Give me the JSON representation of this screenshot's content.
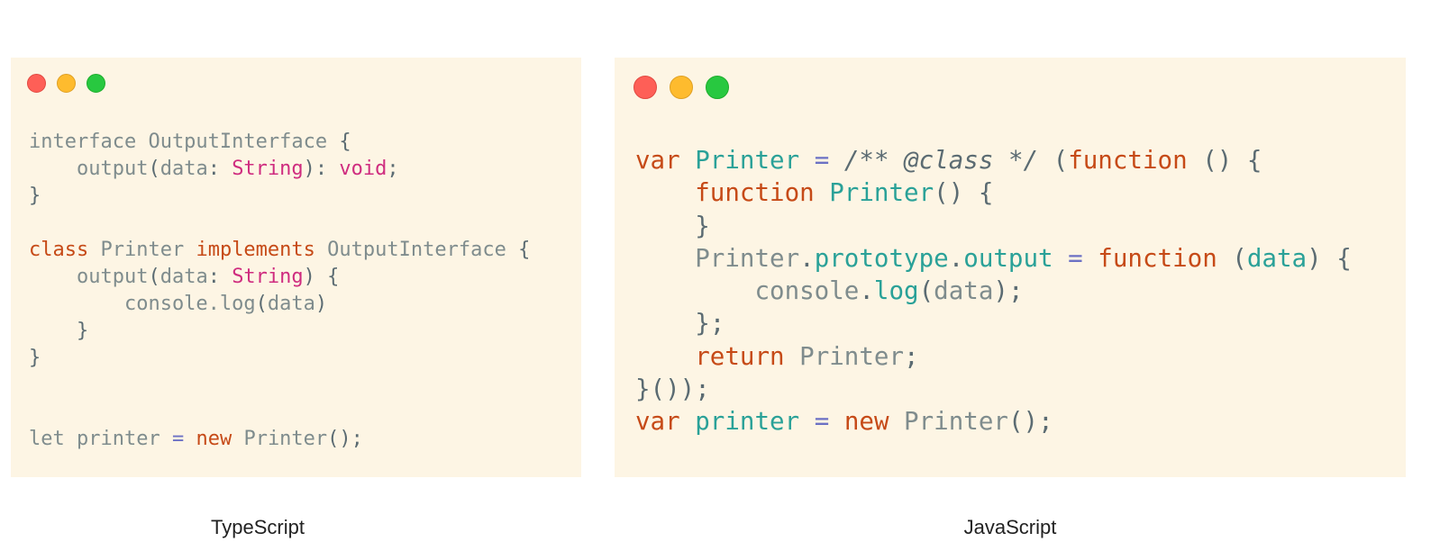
{
  "panels": {
    "typescript": {
      "caption": "TypeScript",
      "lines": [
        [
          [
            "nm",
            "interface OutputInterface "
          ],
          [
            "pl",
            "{"
          ]
        ],
        [
          [
            "nm",
            "    output"
          ],
          [
            "pl",
            "("
          ],
          [
            "nm",
            "data"
          ],
          [
            "pl",
            ": "
          ],
          [
            "ty",
            "String"
          ],
          [
            "pl",
            "): "
          ],
          [
            "ty",
            "void"
          ],
          [
            "pl",
            ";"
          ]
        ],
        [
          [
            "pl",
            "}"
          ]
        ],
        [],
        [
          [
            "kw",
            "class"
          ],
          [
            "nm",
            " Printer "
          ],
          [
            "kw",
            "implements"
          ],
          [
            "nm",
            " OutputInterface "
          ],
          [
            "pl",
            "{"
          ]
        ],
        [
          [
            "nm",
            "    output"
          ],
          [
            "pl",
            "("
          ],
          [
            "nm",
            "data"
          ],
          [
            "pl",
            ": "
          ],
          [
            "ty",
            "String"
          ],
          [
            "pl",
            ") {"
          ]
        ],
        [
          [
            "nm",
            "        console.log"
          ],
          [
            "pl",
            "("
          ],
          [
            "nm",
            "data"
          ],
          [
            "pl",
            ")"
          ]
        ],
        [
          [
            "pl",
            "    }"
          ]
        ],
        [
          [
            "pl",
            "}"
          ]
        ],
        [],
        [],
        [
          [
            "nm",
            "let printer "
          ],
          [
            "op",
            "="
          ],
          [
            "nm",
            " "
          ],
          [
            "kw",
            "new"
          ],
          [
            "nm",
            " Printer"
          ],
          [
            "pl",
            "();"
          ]
        ]
      ]
    },
    "javascript": {
      "caption": "JavaScript",
      "lines": [
        [
          [
            "kw",
            "var"
          ],
          [
            "pl",
            " "
          ],
          [
            "fn",
            "Printer"
          ],
          [
            "pl",
            " "
          ],
          [
            "op",
            "="
          ],
          [
            "pl",
            " "
          ],
          [
            "cm",
            "/** @class */"
          ],
          [
            "pl",
            " ("
          ],
          [
            "kw",
            "function"
          ],
          [
            "pl",
            " () {"
          ]
        ],
        [
          [
            "pl",
            "    "
          ],
          [
            "kw",
            "function"
          ],
          [
            "pl",
            " "
          ],
          [
            "fn",
            "Printer"
          ],
          [
            "pl",
            "() {"
          ]
        ],
        [
          [
            "pl",
            "    }"
          ]
        ],
        [
          [
            "nm",
            "    Printer"
          ],
          [
            "pl",
            "."
          ],
          [
            "fn",
            "prototype"
          ],
          [
            "pl",
            "."
          ],
          [
            "fn",
            "output"
          ],
          [
            "pl",
            " "
          ],
          [
            "op",
            "="
          ],
          [
            "pl",
            " "
          ],
          [
            "kw",
            "function"
          ],
          [
            "pl",
            " ("
          ],
          [
            "fn",
            "data"
          ],
          [
            "pl",
            ") {"
          ]
        ],
        [
          [
            "nm",
            "        console"
          ],
          [
            "pl",
            "."
          ],
          [
            "fn",
            "log"
          ],
          [
            "pl",
            "("
          ],
          [
            "nm",
            "data"
          ],
          [
            "pl",
            ");"
          ]
        ],
        [
          [
            "pl",
            "    };"
          ]
        ],
        [
          [
            "pl",
            "    "
          ],
          [
            "kw",
            "return"
          ],
          [
            "nm",
            " Printer"
          ],
          [
            "pl",
            ";"
          ]
        ],
        [
          [
            "pl",
            "}());"
          ]
        ],
        [
          [
            "kw",
            "var"
          ],
          [
            "pl",
            " "
          ],
          [
            "fn",
            "printer"
          ],
          [
            "pl",
            " "
          ],
          [
            "op",
            "="
          ],
          [
            "pl",
            " "
          ],
          [
            "kw",
            "new"
          ],
          [
            "nm",
            " Printer"
          ],
          [
            "pl",
            "();"
          ]
        ]
      ]
    }
  },
  "window_controls": [
    "close-dot",
    "minimize-dot",
    "maximize-dot"
  ],
  "colors": {
    "panel_background": "#fdf5e4",
    "keyword": "#c64a17",
    "type": "#cf2c7f",
    "function": "#2aa198",
    "operator": "#6c71c4",
    "plain": "#5b6b72",
    "close": "#fe5f57",
    "minimize": "#febb2e",
    "maximize": "#28c840"
  }
}
